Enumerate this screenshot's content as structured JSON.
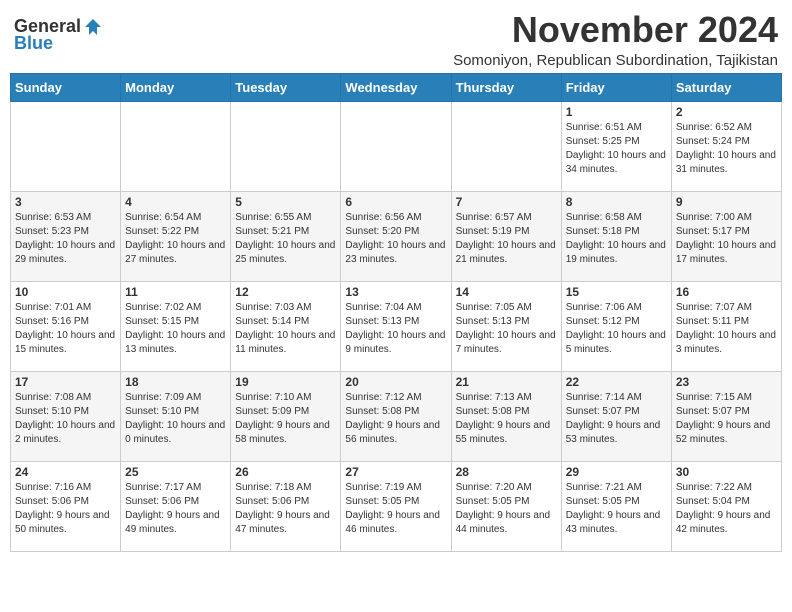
{
  "header": {
    "logo": {
      "general": "General",
      "blue": "Blue",
      "icon_alt": "GeneralBlue logo"
    },
    "title": "November 2024",
    "subtitle": "Somoniyon, Republican Subordination, Tajikistan"
  },
  "calendar": {
    "weekdays": [
      "Sunday",
      "Monday",
      "Tuesday",
      "Wednesday",
      "Thursday",
      "Friday",
      "Saturday"
    ],
    "weeks": [
      [
        {
          "day": "",
          "info": ""
        },
        {
          "day": "",
          "info": ""
        },
        {
          "day": "",
          "info": ""
        },
        {
          "day": "",
          "info": ""
        },
        {
          "day": "",
          "info": ""
        },
        {
          "day": "1",
          "info": "Sunrise: 6:51 AM\nSunset: 5:25 PM\nDaylight: 10 hours and 34 minutes."
        },
        {
          "day": "2",
          "info": "Sunrise: 6:52 AM\nSunset: 5:24 PM\nDaylight: 10 hours and 31 minutes."
        }
      ],
      [
        {
          "day": "3",
          "info": "Sunrise: 6:53 AM\nSunset: 5:23 PM\nDaylight: 10 hours and 29 minutes."
        },
        {
          "day": "4",
          "info": "Sunrise: 6:54 AM\nSunset: 5:22 PM\nDaylight: 10 hours and 27 minutes."
        },
        {
          "day": "5",
          "info": "Sunrise: 6:55 AM\nSunset: 5:21 PM\nDaylight: 10 hours and 25 minutes."
        },
        {
          "day": "6",
          "info": "Sunrise: 6:56 AM\nSunset: 5:20 PM\nDaylight: 10 hours and 23 minutes."
        },
        {
          "day": "7",
          "info": "Sunrise: 6:57 AM\nSunset: 5:19 PM\nDaylight: 10 hours and 21 minutes."
        },
        {
          "day": "8",
          "info": "Sunrise: 6:58 AM\nSunset: 5:18 PM\nDaylight: 10 hours and 19 minutes."
        },
        {
          "day": "9",
          "info": "Sunrise: 7:00 AM\nSunset: 5:17 PM\nDaylight: 10 hours and 17 minutes."
        }
      ],
      [
        {
          "day": "10",
          "info": "Sunrise: 7:01 AM\nSunset: 5:16 PM\nDaylight: 10 hours and 15 minutes."
        },
        {
          "day": "11",
          "info": "Sunrise: 7:02 AM\nSunset: 5:15 PM\nDaylight: 10 hours and 13 minutes."
        },
        {
          "day": "12",
          "info": "Sunrise: 7:03 AM\nSunset: 5:14 PM\nDaylight: 10 hours and 11 minutes."
        },
        {
          "day": "13",
          "info": "Sunrise: 7:04 AM\nSunset: 5:13 PM\nDaylight: 10 hours and 9 minutes."
        },
        {
          "day": "14",
          "info": "Sunrise: 7:05 AM\nSunset: 5:13 PM\nDaylight: 10 hours and 7 minutes."
        },
        {
          "day": "15",
          "info": "Sunrise: 7:06 AM\nSunset: 5:12 PM\nDaylight: 10 hours and 5 minutes."
        },
        {
          "day": "16",
          "info": "Sunrise: 7:07 AM\nSunset: 5:11 PM\nDaylight: 10 hours and 3 minutes."
        }
      ],
      [
        {
          "day": "17",
          "info": "Sunrise: 7:08 AM\nSunset: 5:10 PM\nDaylight: 10 hours and 2 minutes."
        },
        {
          "day": "18",
          "info": "Sunrise: 7:09 AM\nSunset: 5:10 PM\nDaylight: 10 hours and 0 minutes."
        },
        {
          "day": "19",
          "info": "Sunrise: 7:10 AM\nSunset: 5:09 PM\nDaylight: 9 hours and 58 minutes."
        },
        {
          "day": "20",
          "info": "Sunrise: 7:12 AM\nSunset: 5:08 PM\nDaylight: 9 hours and 56 minutes."
        },
        {
          "day": "21",
          "info": "Sunrise: 7:13 AM\nSunset: 5:08 PM\nDaylight: 9 hours and 55 minutes."
        },
        {
          "day": "22",
          "info": "Sunrise: 7:14 AM\nSunset: 5:07 PM\nDaylight: 9 hours and 53 minutes."
        },
        {
          "day": "23",
          "info": "Sunrise: 7:15 AM\nSunset: 5:07 PM\nDaylight: 9 hours and 52 minutes."
        }
      ],
      [
        {
          "day": "24",
          "info": "Sunrise: 7:16 AM\nSunset: 5:06 PM\nDaylight: 9 hours and 50 minutes."
        },
        {
          "day": "25",
          "info": "Sunrise: 7:17 AM\nSunset: 5:06 PM\nDaylight: 9 hours and 49 minutes."
        },
        {
          "day": "26",
          "info": "Sunrise: 7:18 AM\nSunset: 5:06 PM\nDaylight: 9 hours and 47 minutes."
        },
        {
          "day": "27",
          "info": "Sunrise: 7:19 AM\nSunset: 5:05 PM\nDaylight: 9 hours and 46 minutes."
        },
        {
          "day": "28",
          "info": "Sunrise: 7:20 AM\nSunset: 5:05 PM\nDaylight: 9 hours and 44 minutes."
        },
        {
          "day": "29",
          "info": "Sunrise: 7:21 AM\nSunset: 5:05 PM\nDaylight: 9 hours and 43 minutes."
        },
        {
          "day": "30",
          "info": "Sunrise: 7:22 AM\nSunset: 5:04 PM\nDaylight: 9 hours and 42 minutes."
        }
      ]
    ]
  }
}
